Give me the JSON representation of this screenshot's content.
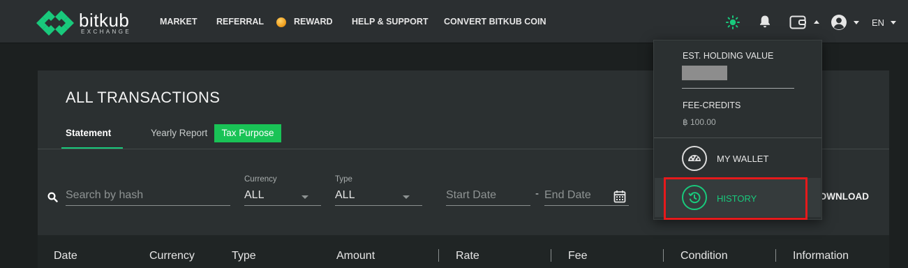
{
  "brand": {
    "name": "bitkub",
    "sub": "EXCHANGE",
    "accent": "#19c97c"
  },
  "nav": {
    "market": "MARKET",
    "referral": "REFERRAL",
    "reward": "REWARD",
    "help": "HELP & SUPPORT",
    "convert": "CONVERT BITKUB COIN",
    "language": "EN",
    "icons": [
      "sun-icon",
      "bell-icon",
      "wallet-icon",
      "user-icon"
    ]
  },
  "page": {
    "title": "ALL TRANSACTIONS",
    "tabs": {
      "statement": "Statement",
      "yearly": "Yearly Report",
      "tax": "Tax Purpose"
    },
    "filters": {
      "search_placeholder": "Search by hash",
      "currency_label": "Currency",
      "currency_value": "ALL",
      "type_label": "Type",
      "type_value": "ALL",
      "start_placeholder": "Start Date",
      "separator": "-",
      "end_placeholder": "End Date",
      "download": "DOWNLOAD"
    },
    "columns": [
      "Date",
      "Currency",
      "Type",
      "Amount",
      "Rate",
      "Fee",
      "Condition",
      "Information"
    ]
  },
  "dropdown": {
    "est_label": "EST. HOLDING VALUE",
    "fee_label": "FEE-CREDITS",
    "fee_value": "฿ 100.00",
    "wallet": "MY WALLET",
    "history": "HISTORY"
  }
}
